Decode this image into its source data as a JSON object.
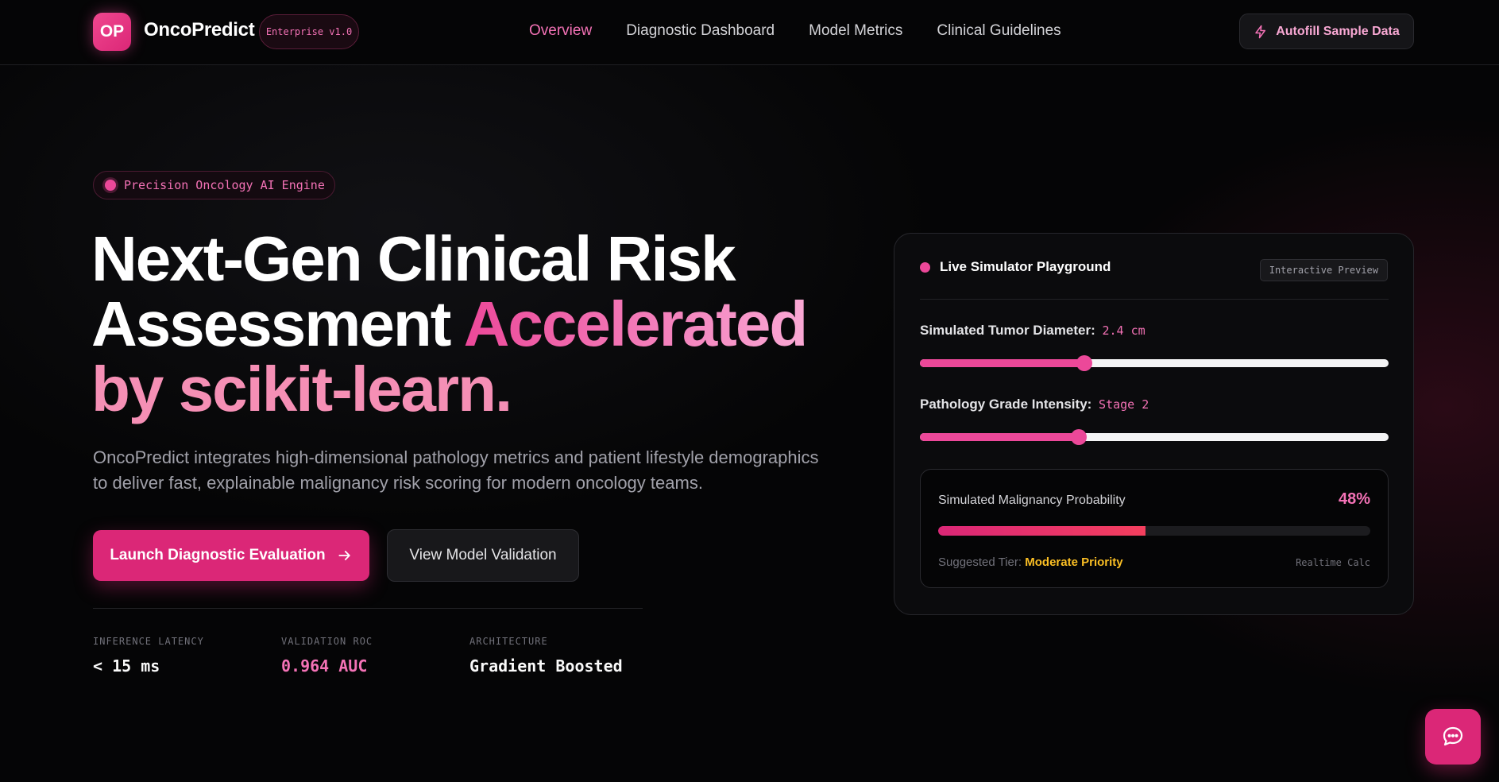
{
  "nav": {
    "logo_initials": "OP",
    "brand": "OncoPredict",
    "version": "Enterprise v1.0",
    "links": [
      {
        "label": "Overview",
        "active": true
      },
      {
        "label": "Diagnostic Dashboard",
        "active": false
      },
      {
        "label": "Model Metrics",
        "active": false
      },
      {
        "label": "Clinical Guidelines",
        "active": false
      }
    ],
    "autofill_label": "Autofill Sample Data",
    "autofill_icon": "lightning-icon"
  },
  "hero": {
    "tag": "Precision Oncology AI Engine",
    "headline_part1": "Next-Gen Clinical Risk",
    "headline_part2": "Assessment ",
    "headline_highlight": "Accelerated",
    "headline_part3": "by scikit-learn.",
    "subtext": "OncoPredict integrates high-dimensional pathology metrics and patient lifestyle demographics to deliver fast, explainable malignancy risk scoring for modern oncology teams.",
    "primary_cta": "Launch Diagnostic Evaluation",
    "secondary_cta": "View Model Validation",
    "stats": [
      {
        "label": "INFERENCE LATENCY",
        "value": "< 15 ms",
        "accent": false
      },
      {
        "label": "VALIDATION ROC",
        "value": "0.964 AUC",
        "accent": true
      },
      {
        "label": "ARCHITECTURE",
        "value": "Gradient Boosted",
        "accent": false
      }
    ]
  },
  "simulator": {
    "title": "Live Simulator Playground",
    "chip": "Interactive Preview",
    "sliders": [
      {
        "label": "Simulated Tumor Diameter:",
        "value": "2.4 cm",
        "fraction": 0.35
      },
      {
        "label": "Pathology Grade Intensity:",
        "value": "Stage 2",
        "fraction": 0.339
      }
    ],
    "probability_label": "Simulated Malignancy Probability",
    "probability_value": "48%",
    "probability_fraction": 0.48,
    "tier_label": "Suggested Tier:",
    "tier_value": "Moderate Priority",
    "calc_label": "Realtime Calc"
  },
  "colors": {
    "accent": "#ec4899",
    "accent_dark": "#db2777",
    "tier": "#fbbf24",
    "background": "#050506"
  },
  "chat": {
    "icon": "chat-bubble-icon"
  }
}
